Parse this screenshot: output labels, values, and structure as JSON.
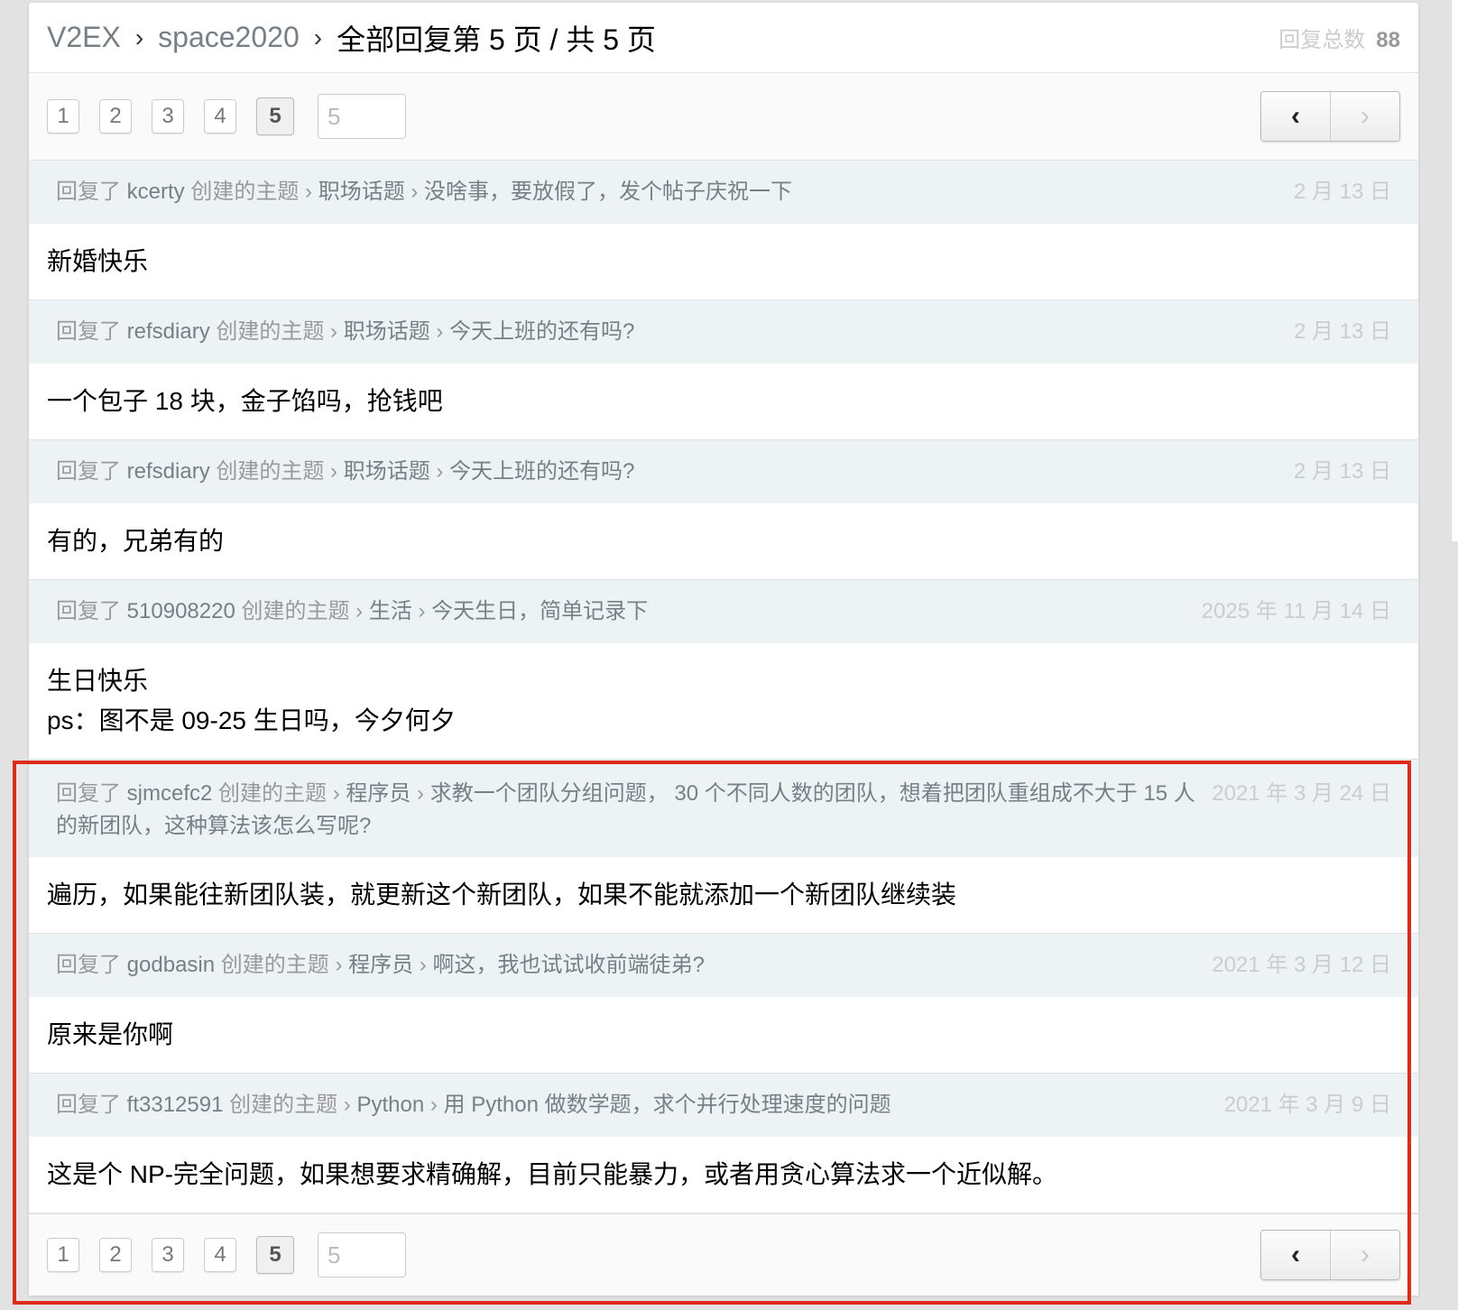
{
  "header": {
    "crumbs": [
      "V2EX",
      "space2020"
    ],
    "separator": "›",
    "current": "全部回复第 5 页 / 共 5 页",
    "total_label": "回复总数",
    "total_value": "88"
  },
  "pager": {
    "pages": [
      "1",
      "2",
      "3",
      "4",
      "5"
    ],
    "current_page": "5",
    "input_value": "5",
    "prev_icon": "‹",
    "next_icon": "›"
  },
  "replies": [
    {
      "prefix": "回复了",
      "user": "kcerty",
      "mid": "创建的主题",
      "sep": "›",
      "node": "职场话题",
      "topic": "没啥事，要放假了，发个帖子庆祝一下",
      "date": "2 月 13 日",
      "content": [
        "新婚快乐"
      ]
    },
    {
      "prefix": "回复了",
      "user": "refsdiary",
      "mid": "创建的主题",
      "sep": "›",
      "node": "职场话题",
      "topic": "今天上班的还有吗?",
      "date": "2 月 13 日",
      "content": [
        "一个包子 18 块，金子馅吗，抢钱吧"
      ]
    },
    {
      "prefix": "回复了",
      "user": "refsdiary",
      "mid": "创建的主题",
      "sep": "›",
      "node": "职场话题",
      "topic": "今天上班的还有吗?",
      "date": "2 月 13 日",
      "content": [
        "有的，兄弟有的"
      ]
    },
    {
      "prefix": "回复了",
      "user": "510908220",
      "mid": "创建的主题",
      "sep": "›",
      "node": "生活",
      "topic": "今天生日，简单记录下",
      "date": "2025 年 11 月 14 日",
      "content": [
        "生日快乐",
        "ps：图不是 09-25 生日吗，今夕何夕"
      ]
    },
    {
      "prefix": "回复了",
      "user": "sjmcefc2",
      "mid": "创建的主题",
      "sep": "›",
      "node": "程序员",
      "topic": "求教一个团队分组问题， 30 个不同人数的团队，想着把团队重组成不大于 15 人的新团队，这种算法该怎么写呢?",
      "date": "2021 年 3 月 24 日",
      "content": [
        "遍历，如果能往新团队装，就更新这个新团队，如果不能就添加一个新团队继续装"
      ]
    },
    {
      "prefix": "回复了",
      "user": "godbasin",
      "mid": "创建的主题",
      "sep": "›",
      "node": "程序员",
      "topic": "啊这，我也试试收前端徒弟?",
      "date": "2021 年 3 月 12 日",
      "content": [
        "原来是你啊"
      ]
    },
    {
      "prefix": "回复了",
      "user": "ft3312591",
      "mid": "创建的主题",
      "sep": "›",
      "node": "Python",
      "topic": "用 Python 做数学题，求个并行处理速度的问题",
      "date": "2021 年 3 月 9 日",
      "content": [
        "这是个 NP-完全问题，如果想要求精确解，目前只能暴力，或者用贪心算法求一个近似解。"
      ]
    }
  ],
  "colors": {
    "highlight_border": "#e02a1c",
    "dock_bg": "#edf3f5",
    "link": "#778087"
  }
}
